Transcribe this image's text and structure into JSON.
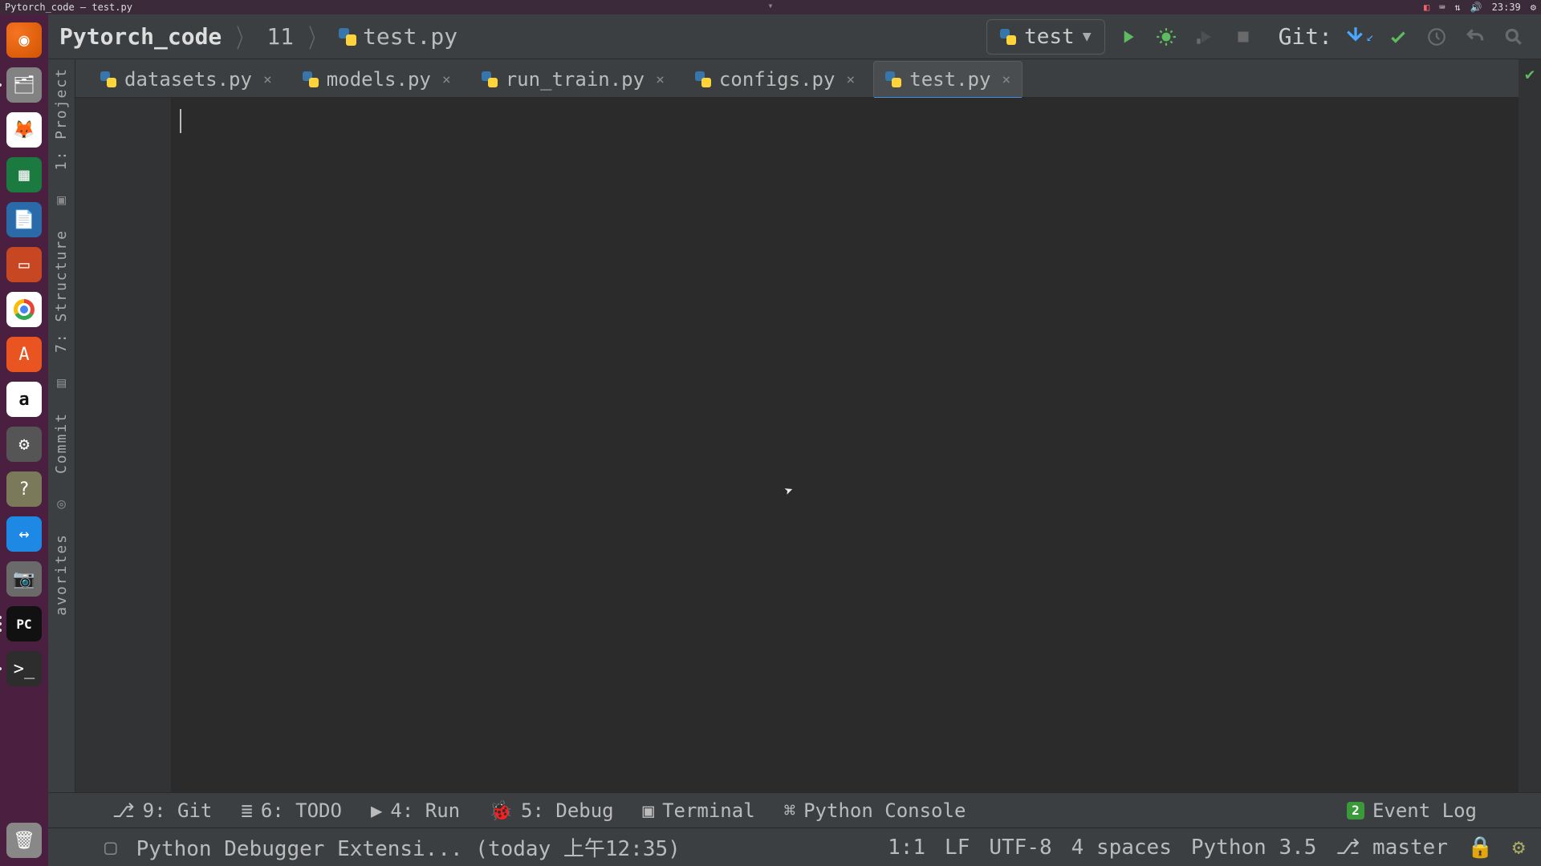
{
  "desktop": {
    "window_title": "Pytorch_code – test.py",
    "time": "23:39",
    "tray": {
      "keyrate_icon": "keyboard-icon",
      "mail_icon": "mail-icon",
      "net_icon": "network-icon",
      "vol_icon": "volume-icon",
      "power_icon": "power-icon"
    }
  },
  "toolbar": {
    "breadcrumbs": {
      "root": "Pytorch_code",
      "folder": "11",
      "file": "test.py"
    },
    "run_config": "test",
    "git_label": "Git:"
  },
  "tabs": [
    {
      "label": "datasets.py",
      "active": false
    },
    {
      "label": "models.py",
      "active": false
    },
    {
      "label": "run_train.py",
      "active": false
    },
    {
      "label": "configs.py",
      "active": false
    },
    {
      "label": "test.py",
      "active": true
    }
  ],
  "left_tools": {
    "project": "1: Project",
    "structure": "7: Structure",
    "commit": "Commit",
    "favorites": "avorites"
  },
  "bottom_tabs": {
    "git": "9: Git",
    "todo": "6: TODO",
    "run": "4: Run",
    "debug": "5: Debug",
    "terminal": "Terminal",
    "pycon": "Python Console",
    "eventlog": "Event Log",
    "event_badge": "2"
  },
  "status": {
    "msg": "Python Debugger Extensi... (today 上午12:35)",
    "pos": "1:1",
    "eol": "LF",
    "enc": "UTF-8",
    "indent": "4 spaces",
    "py": "Python 3.5",
    "branch": "master"
  }
}
